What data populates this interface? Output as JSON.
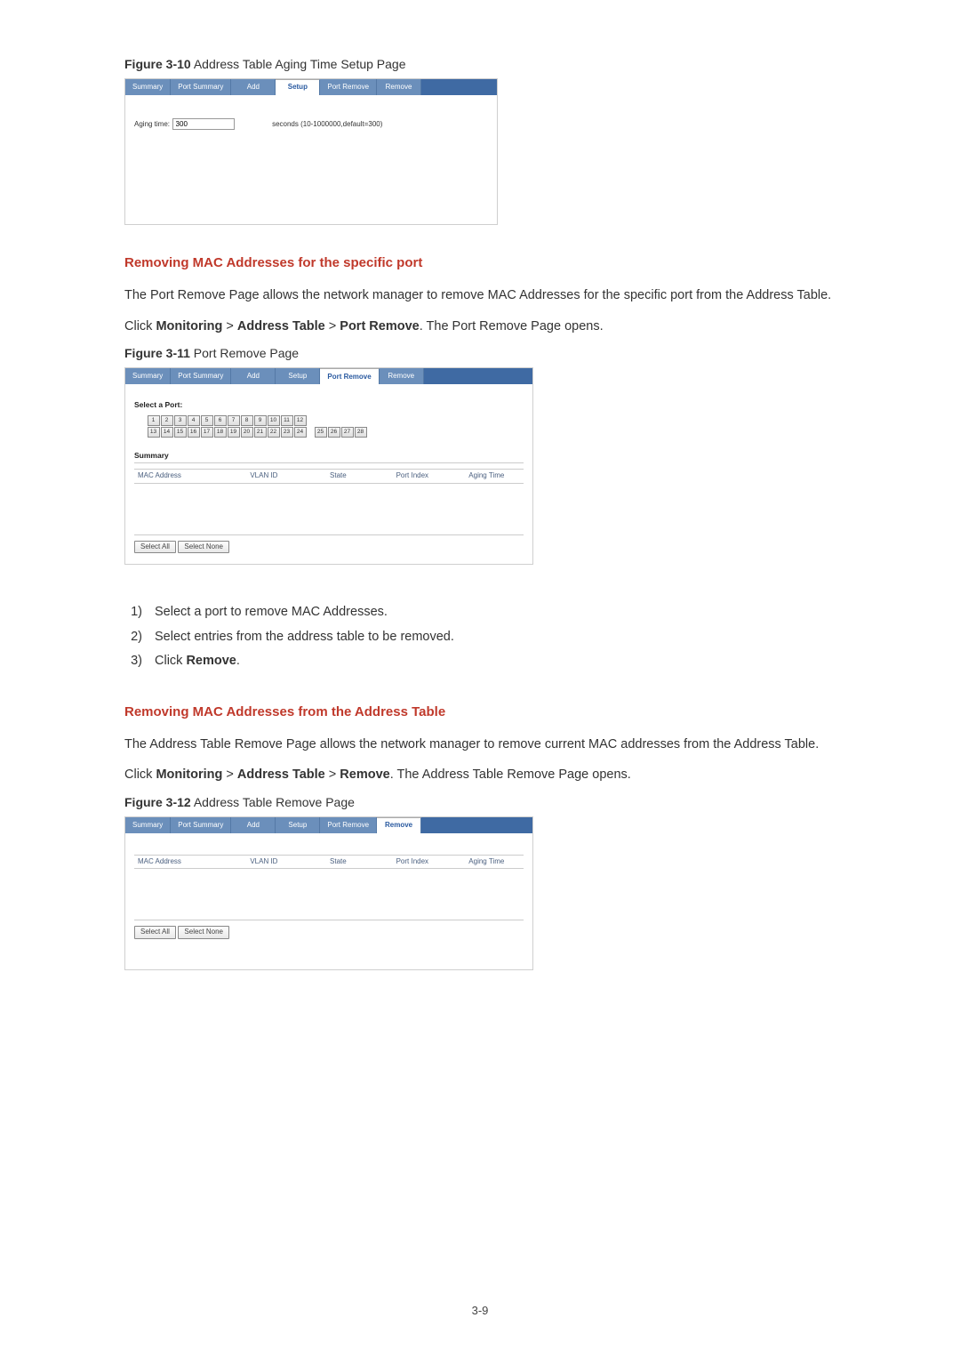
{
  "fig10": {
    "label": "Figure 3-10",
    "caption": " Address Table Aging Time Setup Page",
    "tabs": [
      "Summary",
      "Port Summary",
      "Add",
      "Setup",
      "Port Remove",
      "Remove"
    ],
    "active_tab": 3,
    "aging_label": "Aging time:",
    "aging_value": "300",
    "aging_hint": "seconds (10-1000000,default=300)"
  },
  "sec1": {
    "title": "Removing MAC Addresses for the specific port",
    "para1": "The Port Remove Page allows the network manager to remove MAC Addresses for the specific port from the Address Table.",
    "para2_pre": "Click ",
    "para2_b1": "Monitoring",
    "para2_sep": " > ",
    "para2_b2": "Address Table",
    "para2_b3": "Port Remove",
    "para2_post": ". The Port Remove Page opens."
  },
  "fig11": {
    "label": "Figure 3-11",
    "caption": " Port Remove Page",
    "tabs": [
      "Summary",
      "Port Summary",
      "Add",
      "Setup",
      "Port Remove",
      "Remove"
    ],
    "active_tab": 4,
    "select_port_label": "Select a Port:",
    "ports_row1": [
      "1",
      "2",
      "3",
      "4",
      "5",
      "6",
      "7",
      "8",
      "9",
      "10",
      "11",
      "12"
    ],
    "ports_row2": [
      "13",
      "14",
      "15",
      "16",
      "17",
      "18",
      "19",
      "20",
      "21",
      "22",
      "23",
      "24"
    ],
    "ports_extra": [
      "25",
      "26",
      "27",
      "28"
    ],
    "summary_label": "Summary",
    "cols": [
      "MAC Address",
      "VLAN ID",
      "State",
      "Port Index",
      "Aging Time"
    ],
    "btn_select_all": "Select All",
    "btn_select_none": "Select None"
  },
  "steps": {
    "s1_pre": "Select a port to remove MAC Addresses.",
    "s2_pre": "Select entries from the address table to be removed.",
    "s3_pre": "Click ",
    "s3_b": "Remove",
    "s3_post": "."
  },
  "sec2": {
    "title": "Removing MAC Addresses from the Address Table",
    "para1": "The Address Table Remove Page allows the network manager to remove current MAC addresses from the Address Table.",
    "para2_pre": "Click ",
    "para2_b1": "Monitoring",
    "para2_sep": " > ",
    "para2_b2": "Address Table",
    "para2_b3": "Remove",
    "para2_post": ". The Address Table Remove Page opens."
  },
  "fig12": {
    "label": "Figure 3-12",
    "caption": " Address Table Remove Page",
    "tabs": [
      "Summary",
      "Port Summary",
      "Add",
      "Setup",
      "Port Remove",
      "Remove"
    ],
    "active_tab": 5,
    "cols": [
      "MAC Address",
      "VLAN ID",
      "State",
      "Port Index",
      "Aging Time"
    ],
    "btn_select_all": "Select All",
    "btn_select_none": "Select None"
  },
  "page_number": "3-9"
}
